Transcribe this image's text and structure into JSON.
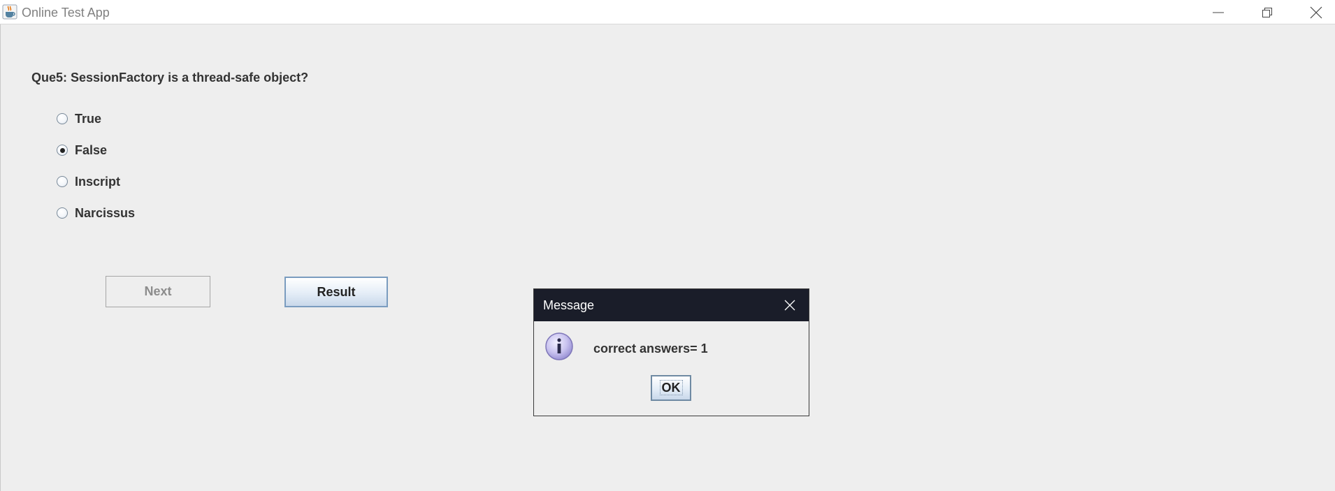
{
  "window": {
    "title": "Online Test App",
    "icon": "java-cup-icon",
    "controls": [
      "minimize-icon",
      "restore-icon",
      "close-icon"
    ]
  },
  "question": {
    "text": "Que5: SessionFactory is a thread-safe object?",
    "options": [
      {
        "label": "True",
        "selected": false
      },
      {
        "label": "False",
        "selected": true
      },
      {
        "label": "Inscript",
        "selected": false
      },
      {
        "label": "Narcissus",
        "selected": false
      }
    ]
  },
  "buttons": {
    "next_label": "Next",
    "next_enabled": false,
    "result_label": "Result"
  },
  "dialog": {
    "title": "Message",
    "icon": "info-icon",
    "message": "correct answers= 1",
    "ok_label": "OK"
  },
  "colors": {
    "background": "#eeeeee",
    "dialog_titlebar": "#1a1d29",
    "button_border": "#7a9cbf",
    "info_icon_fill": "#c9c3ef"
  }
}
